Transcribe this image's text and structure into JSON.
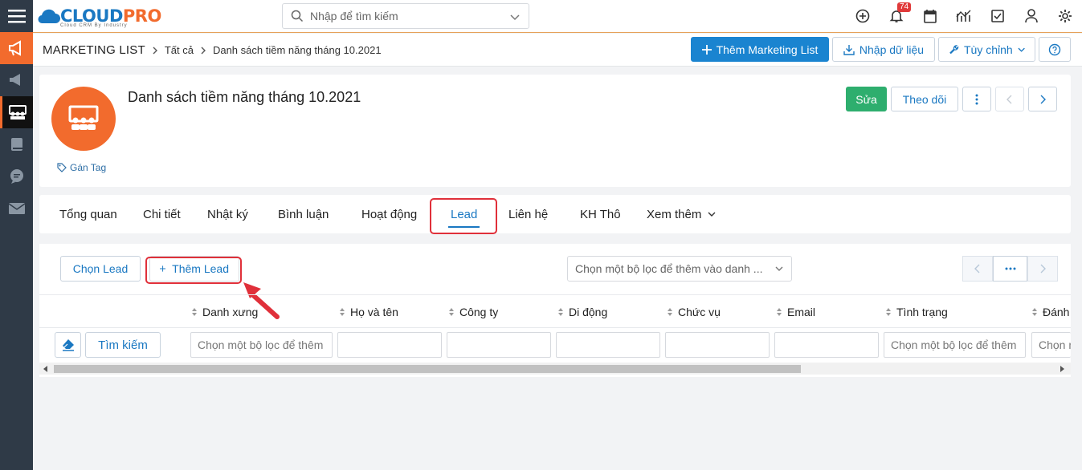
{
  "app": {
    "logo_main": "CLOUD",
    "logo_accent": "PRO",
    "logo_tagline": "Cloud CRM By Industry"
  },
  "search": {
    "placeholder": "Nhập để tìm kiếm"
  },
  "notifications": {
    "count": "74"
  },
  "breadcrumb": {
    "root": "MARKETING LIST",
    "level1": "Tất cả",
    "current": "Danh sách tiềm năng tháng 10.2021"
  },
  "header_actions": {
    "add_label": "Thêm Marketing List",
    "import_label": "Nhập dữ liệu",
    "customize_label": "Tùy chỉnh"
  },
  "record": {
    "title": "Danh sách tiềm năng tháng 10.2021",
    "tag_label": "Gán Tag",
    "edit_label": "Sửa",
    "follow_label": "Theo dõi"
  },
  "tabs": [
    {
      "label": "Tổng quan"
    },
    {
      "label": "Chi tiết"
    },
    {
      "label": "Nhật ký"
    },
    {
      "label": "Bình luận"
    },
    {
      "label": "Hoạt động"
    },
    {
      "label": "Lead",
      "active": true
    },
    {
      "label": "Liên hệ"
    },
    {
      "label": "KH Thô"
    },
    {
      "label": "Xem thêm"
    }
  ],
  "list_toolbar": {
    "select_label": "Chọn Lead",
    "add_label": "Thêm Lead",
    "filter_placeholder": "Chọn một bộ lọc để thêm vào danh ..."
  },
  "table": {
    "columns": [
      "Danh xưng",
      "Họ và tên",
      "Công ty",
      "Di động",
      "Chức vụ",
      "Email",
      "Tình trạng",
      "Đánh"
    ],
    "search_label": "Tìm kiếm",
    "filter_placeholder": "Chọn một bộ lọc để thêm",
    "filter_placeholder_short": "Chọn m"
  },
  "colors": {
    "brand_orange": "#f26b2d",
    "brand_blue": "#1a78c2",
    "sidebar_bg": "#2f3a47",
    "highlight_red": "#e0303a",
    "edit_green": "#2eae6e"
  }
}
